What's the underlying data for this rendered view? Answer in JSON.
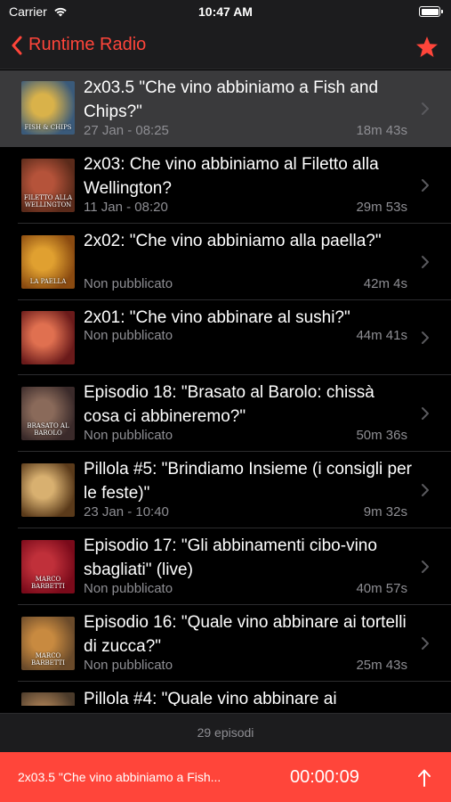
{
  "status": {
    "carrier": "Carrier",
    "time": "10:47 AM"
  },
  "nav": {
    "back_label": "Runtime Radio",
    "accent": "#ff453a"
  },
  "episodes": [
    {
      "title": "2x03.5 \"Che vino abbiniamo a Fish and Chips?\"",
      "date": "27 Jan - 08:25",
      "duration": "18m 43s",
      "thumb_text": "FISH & CHIPS",
      "thumb_colors": [
        "#3a5a7a",
        "#d9b24a"
      ]
    },
    {
      "title": "2x03: Che vino abbiniamo al Filetto alla Wellington?",
      "date": "11 Jan - 08:20",
      "duration": "29m 53s",
      "thumb_text": "FILETTO ALLA WELLINGTON",
      "thumb_colors": [
        "#5a2a1a",
        "#b5533a"
      ]
    },
    {
      "title": "2x02: \"Che vino abbiniamo alla paella?\"",
      "date": "Non pubblicato",
      "duration": "42m 4s",
      "thumb_text": "LA PAELLA",
      "thumb_colors": [
        "#8a4a10",
        "#e0a030"
      ]
    },
    {
      "title": "2x01: \"Che vino abbinare al sushi?\"",
      "date": "Non pubblicato",
      "duration": "44m 41s",
      "thumb_text": "",
      "thumb_colors": [
        "#6a1a1a",
        "#e07050"
      ]
    },
    {
      "title": "Episodio 18: \"Brasato al Barolo: chissà cosa ci abbineremo?\"",
      "date": "Non pubblicato",
      "duration": "50m 36s",
      "thumb_text": "BRASATO AL BAROLO",
      "thumb_colors": [
        "#3a2a2a",
        "#8a6a5a"
      ]
    },
    {
      "title": "Pillola #5: \"Brindiamo Insieme (i consigli per le feste)\"",
      "date": "23 Jan - 10:40",
      "duration": "9m 32s",
      "thumb_text": "",
      "thumb_colors": [
        "#5a3a1a",
        "#d8b070"
      ]
    },
    {
      "title": "Episodio 17: \"Gli abbinamenti cibo-vino sbagliati\" (live)",
      "date": "Non pubblicato",
      "duration": "40m 57s",
      "thumb_text": "MARCO BARBETTI",
      "thumb_colors": [
        "#7a0a1a",
        "#c0303a"
      ]
    },
    {
      "title": "Episodio 16: \"Quale vino abbinare ai tortelli di zucca?\"",
      "date": "Non pubblicato",
      "duration": "25m 43s",
      "thumb_text": "MARCO BARBETTI",
      "thumb_colors": [
        "#6a4a2a",
        "#c88a40"
      ]
    },
    {
      "title": "Pillola #4: \"Quale vino abbinare ai",
      "date": "",
      "duration": "",
      "thumb_text": "",
      "thumb_colors": [
        "#4a3a2a",
        "#a07850"
      ]
    }
  ],
  "footer": {
    "count": "29 episodi"
  },
  "player": {
    "title": "2x03.5 \"Che vino abbiniamo a Fish...",
    "time": "00:00:09"
  }
}
